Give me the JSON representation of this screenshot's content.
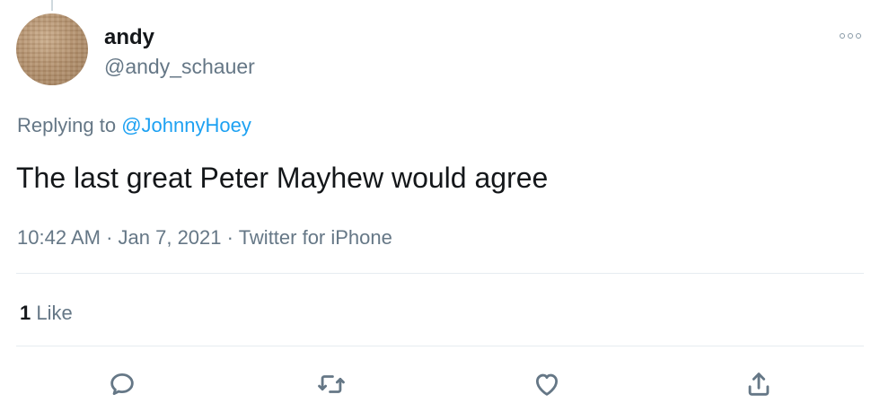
{
  "tweet": {
    "author": {
      "display_name": "andy",
      "handle": "@andy_schauer",
      "avatar_icon": "avatar-image"
    },
    "replying_prefix": "Replying to",
    "replying_to": "@JohnnyHoey",
    "text": "The last great Peter Mayhew would agree",
    "time": "10:42 AM",
    "date": "Jan 7, 2021",
    "source": "Twitter for iPhone",
    "separator": "·",
    "likes_count": "1",
    "likes_label": "Like"
  },
  "actions": [
    {
      "name": "reply",
      "icon": "reply-icon"
    },
    {
      "name": "retweet",
      "icon": "retweet-icon"
    },
    {
      "name": "like",
      "icon": "heart-icon"
    },
    {
      "name": "share",
      "icon": "share-icon"
    }
  ],
  "colors": {
    "text_primary": "#14171a",
    "text_secondary": "#657786",
    "link": "#1da1f2",
    "divider": "#e6ecf0"
  }
}
